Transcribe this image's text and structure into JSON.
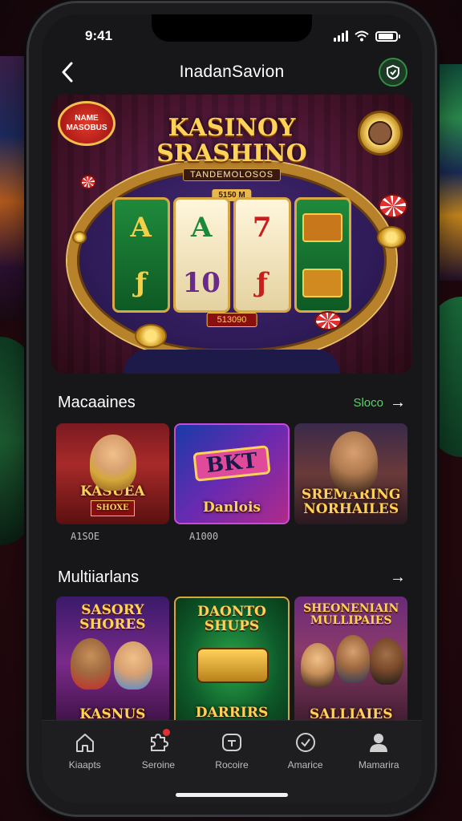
{
  "status": {
    "time": "9:41"
  },
  "nav": {
    "title": "InadanSavion"
  },
  "hero": {
    "badge": "NAME MASOBUS",
    "title_line1": "KASINOY",
    "title_line2": "SRASHINO",
    "subtitle": "TANDEMOLOSOS",
    "tag": "5150 M",
    "reel_label": "513090"
  },
  "sections": [
    {
      "title": "Macaaines",
      "see_all": "Sloco",
      "cards": [
        {
          "label": "KASUEA",
          "sub": "SHOXE",
          "meta": "A1SOE"
        },
        {
          "label": "Danlois",
          "sub": "BKT",
          "meta": "A1000"
        },
        {
          "label": "SREMARING NORHAILES",
          "sub": "",
          "meta": ""
        }
      ]
    },
    {
      "title": "Multiiarlans",
      "see_all": "",
      "cards": [
        {
          "top": "SASORY SHORES",
          "label": "KASNUS"
        },
        {
          "top": "DAONTO SHUPS",
          "label": "DARRIRS"
        },
        {
          "top": "SHEONENIAIN MULLIPAIES",
          "label": "SALLIAIES"
        }
      ]
    }
  ],
  "tabs": [
    {
      "label": "Kiaapts",
      "icon": "home-icon"
    },
    {
      "label": "Seroine",
      "icon": "puzzle-icon"
    },
    {
      "label": "Rocoire",
      "icon": "wallet-icon"
    },
    {
      "label": "Amarice",
      "icon": "check-icon"
    },
    {
      "label": "Mamarira",
      "icon": "profile-icon"
    }
  ]
}
